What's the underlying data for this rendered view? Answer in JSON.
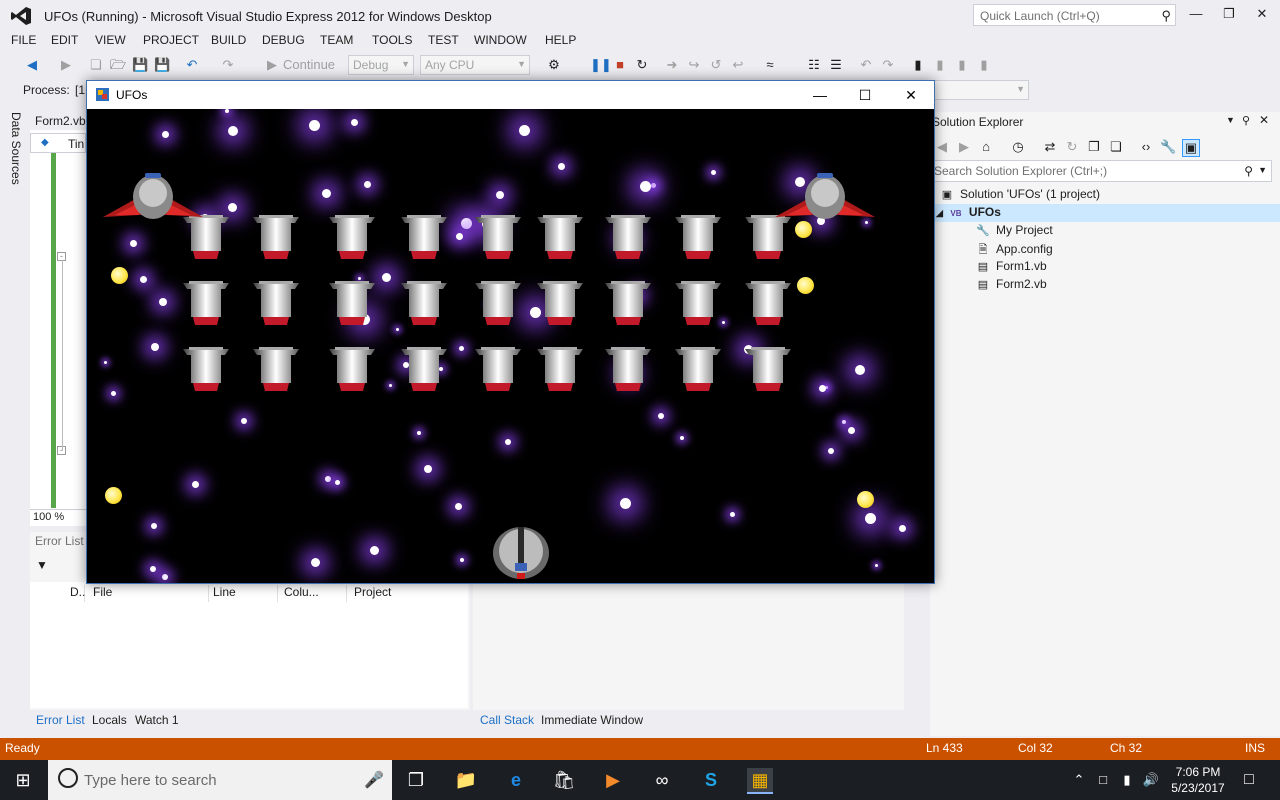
{
  "window": {
    "title": "UFOs (Running) - Microsoft Visual Studio Express 2012 for Windows Desktop",
    "quick_launch_placeholder": "Quick Launch (Ctrl+Q)"
  },
  "menu": [
    "FILE",
    "EDIT",
    "VIEW",
    "PROJECT",
    "BUILD",
    "DEBUG",
    "TEAM",
    "TOOLS",
    "TEST",
    "WINDOW",
    "HELP"
  ],
  "toolbar": {
    "continue_label": "Continue",
    "config_value": "Debug",
    "platform_value": "Any CPU"
  },
  "process": {
    "label": "Process:",
    "value": "[1"
  },
  "side": {
    "data_sources": "Data Sources"
  },
  "editor": {
    "tab_label": "Form2.vb",
    "combo_text": "Tin",
    "zoom": "100 %"
  },
  "error_list": {
    "title": "Error List",
    "columns": [
      "D..",
      "File",
      "Line",
      "Colu...",
      "Project"
    ]
  },
  "bottom_tabs_left": [
    "Error List",
    "Locals",
    "Watch 1"
  ],
  "bottom_tabs_right": [
    "Call Stack",
    "Immediate Window"
  ],
  "solution_explorer": {
    "title": "Solution Explorer",
    "search_placeholder": "Search Solution Explorer (Ctrl+;)",
    "items": [
      {
        "label": "Solution 'UFOs' (1 project)",
        "icon": "solution-icon"
      },
      {
        "label": "UFOs",
        "icon": "vb-project-icon"
      },
      {
        "label": "My Project",
        "icon": "wrench-icon"
      },
      {
        "label": "App.config",
        "icon": "config-file-icon"
      },
      {
        "label": "Form1.vb",
        "icon": "form-icon"
      },
      {
        "label": "Form2.vb",
        "icon": "form-icon"
      }
    ]
  },
  "status": {
    "ready": "Ready",
    "ln": "Ln 433",
    "col": "Col 32",
    "ch": "Ch 32",
    "mode": "INS"
  },
  "game": {
    "title": "UFOs"
  },
  "taskbar": {
    "search_placeholder": "Type here to search",
    "time": "7:06 PM",
    "date": "5/23/2017"
  },
  "colors": {
    "accent_status": "#ca5100",
    "taskbar": "#1b1e23",
    "selection": "#cce8ff"
  }
}
